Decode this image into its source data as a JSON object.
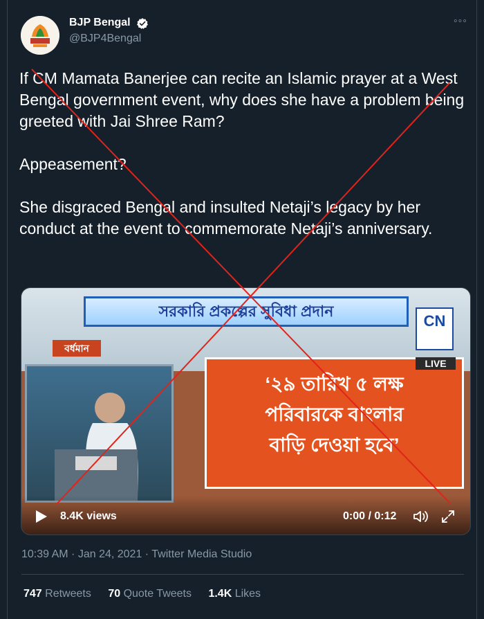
{
  "user": {
    "name": "BJP Bengal",
    "handle": "@BJP4Bengal",
    "verified": true
  },
  "tweet": {
    "paragraphs": [
      "If CM Mamata Banerjee can recite an Islamic prayer at a West Bengal government event, why does she have a problem being greeted with Jai Shree Ram?",
      "Appeasement?",
      "She disgraced Bengal and insulted Netaji’s legacy by her conduct at the event to commemorate Netaji’s anniversary."
    ]
  },
  "media": {
    "banner_text": "সরকারি প্রকল্পের সুবিধা প্রদান",
    "location_tag": "বর্ধমান",
    "panel_lines": [
      "‘২৯ তারিখ ৫ লক্ষ",
      "পরিবারকে বাংলার",
      "বাড়ি দেওয়া হবে’"
    ],
    "channel_logo": "CN",
    "live_label": "LIVE",
    "views": "8.4K views",
    "time": "0:00 / 0:12"
  },
  "meta": {
    "timestamp": "10:39 AM · Jan 24, 2021 · Twitter Media Studio"
  },
  "stats": {
    "retweets_count": "747",
    "retweets_label": "Retweets",
    "quotes_count": "70",
    "quotes_label": "Quote Tweets",
    "likes_count": "1.4K",
    "likes_label": "Likes"
  },
  "colors": {
    "background": "#15202b",
    "muted": "#8899a6",
    "verified": "#ffffff",
    "cross": "#e0241b"
  },
  "icons": [
    "verified-badge-icon",
    "more-icon",
    "play-icon",
    "volume-icon",
    "expand-icon"
  ]
}
